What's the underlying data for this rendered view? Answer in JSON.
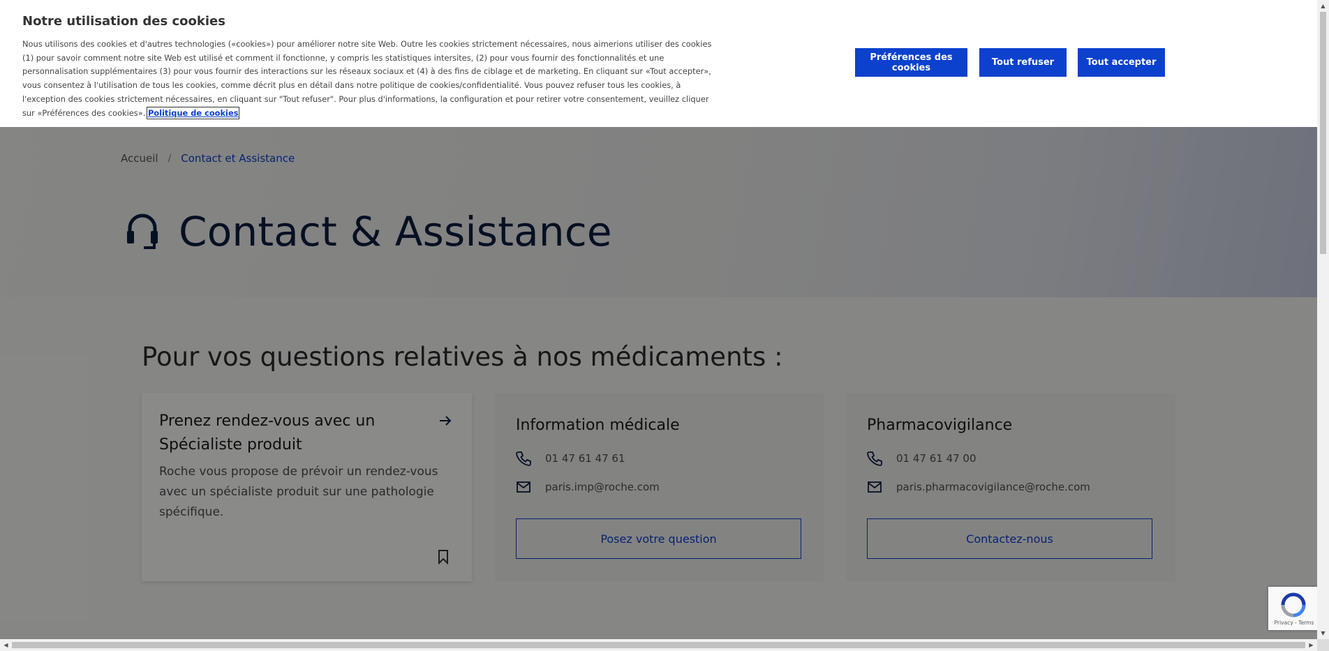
{
  "cookie_banner": {
    "title": "Notre utilisation des cookies",
    "text": "Nous utilisons des cookies et d'autres technologies («cookies») pour améliorer notre site Web. Outre les cookies strictement nécessaires, nous aimerions utiliser des cookies (1) pour savoir comment notre site Web est utilisé et comment il fonctionne, y compris les statistiques intersites, (2) pour vous fournir des fonctionnalités et une personnalisation supplémentaires (3) pour vous fournir des interactions sur les réseaux sociaux et (4) à des fins de ciblage et de marketing. En cliquant sur «Tout accepter», vous consentez à l'utilisation de tous les cookies, comme décrit plus en détail dans notre politique de cookies/confidentialité. Vous pouvez refuser tous les cookies, à l'exception des cookies strictement nécessaires, en cliquant sur \"Tout refuser\". Pour plus d'informations, la configuration et pour retirer votre consentement, veuillez cliquer sur «Préférences des cookies».",
    "policy_link": "Politique de cookies",
    "buttons": {
      "preferences": "Préférences des cookies",
      "refuse": "Tout refuser",
      "accept": "Tout accepter"
    }
  },
  "breadcrumb": {
    "home": "Accueil",
    "separator": "/",
    "current": "Contact et Assistance"
  },
  "hero": {
    "icon": "headset-icon",
    "title": "Contact & Assistance"
  },
  "section": {
    "title": "Pour vos questions relatives à nos médicaments :"
  },
  "cards": {
    "appointment": {
      "title": "Prenez rendez-vous avec un Spécialiste produit",
      "text": "Roche vous propose de prévoir un rendez-vous avec un spécialiste produit sur une pathologie spécifique.",
      "icons": [
        "arrow-right-icon",
        "bookmark-icon"
      ]
    },
    "medical_info": {
      "title": "Information médicale",
      "phone": "01 47 61 47 61",
      "email": "paris.imp@roche.com",
      "button": "Posez votre question"
    },
    "pharmacovigilance": {
      "title": "Pharmacovigilance",
      "phone": "01 47 61 47 00",
      "email": "paris.pharmacovigilance@roche.com",
      "button": "Contactez-nous"
    }
  },
  "recaptcha": {
    "label": "Privacy - Terms"
  },
  "colors": {
    "accent": "#0b41cd",
    "navy": "#0b1e40",
    "background": "#f5f5f2"
  }
}
